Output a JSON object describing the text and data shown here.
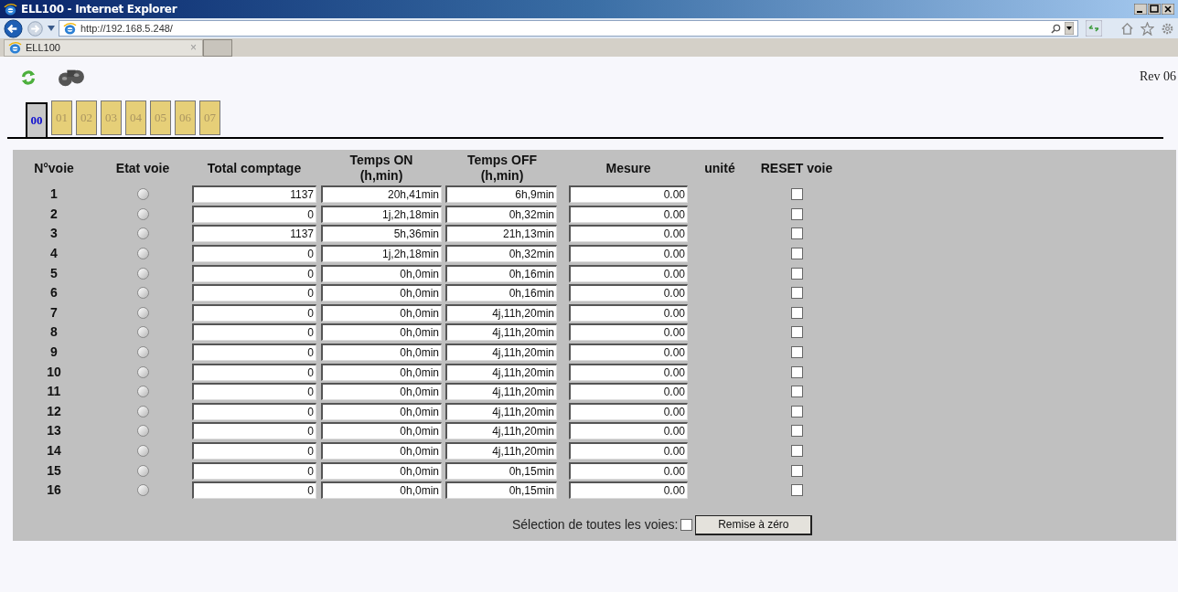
{
  "window": {
    "title": "ELL100 - Internet Explorer"
  },
  "address_bar": {
    "url": "http://192.168.5.248/"
  },
  "browser_tab": {
    "label": "ELL100",
    "close": "×"
  },
  "page": {
    "revision": "Rev 06",
    "tabs": [
      {
        "label": "00",
        "selected": true
      },
      {
        "label": "01",
        "selected": false
      },
      {
        "label": "02",
        "selected": false
      },
      {
        "label": "03",
        "selected": false
      },
      {
        "label": "04",
        "selected": false
      },
      {
        "label": "05",
        "selected": false
      },
      {
        "label": "06",
        "selected": false
      },
      {
        "label": "07",
        "selected": false
      }
    ],
    "columns": [
      "N°voie",
      "Etat voie",
      "Total comptage",
      "Temps ON\n(h,min)",
      "Temps OFF\n(h,min)",
      "Mesure",
      "unité",
      "RESET voie"
    ],
    "rows": [
      {
        "channel": "1",
        "on": false,
        "total": "1137",
        "time_on": "20h,41min",
        "time_off": "6h,9min",
        "measure": "0.00",
        "reset": false
      },
      {
        "channel": "2",
        "on": false,
        "total": "0",
        "time_on": "1j,2h,18min",
        "time_off": "0h,32min",
        "measure": "0.00",
        "reset": false
      },
      {
        "channel": "3",
        "on": false,
        "total": "1137",
        "time_on": "5h,36min",
        "time_off": "21h,13min",
        "measure": "0.00",
        "reset": false
      },
      {
        "channel": "4",
        "on": false,
        "total": "0",
        "time_on": "1j,2h,18min",
        "time_off": "0h,32min",
        "measure": "0.00",
        "reset": false
      },
      {
        "channel": "5",
        "on": false,
        "total": "0",
        "time_on": "0h,0min",
        "time_off": "0h,16min",
        "measure": "0.00",
        "reset": false
      },
      {
        "channel": "6",
        "on": false,
        "total": "0",
        "time_on": "0h,0min",
        "time_off": "0h,16min",
        "measure": "0.00",
        "reset": false
      },
      {
        "channel": "7",
        "on": false,
        "total": "0",
        "time_on": "0h,0min",
        "time_off": "4j,11h,20min",
        "measure": "0.00",
        "reset": false
      },
      {
        "channel": "8",
        "on": false,
        "total": "0",
        "time_on": "0h,0min",
        "time_off": "4j,11h,20min",
        "measure": "0.00",
        "reset": false
      },
      {
        "channel": "9",
        "on": false,
        "total": "0",
        "time_on": "0h,0min",
        "time_off": "4j,11h,20min",
        "measure": "0.00",
        "reset": false
      },
      {
        "channel": "10",
        "on": false,
        "total": "0",
        "time_on": "0h,0min",
        "time_off": "4j,11h,20min",
        "measure": "0.00",
        "reset": false
      },
      {
        "channel": "11",
        "on": false,
        "total": "0",
        "time_on": "0h,0min",
        "time_off": "4j,11h,20min",
        "measure": "0.00",
        "reset": false
      },
      {
        "channel": "12",
        "on": false,
        "total": "0",
        "time_on": "0h,0min",
        "time_off": "4j,11h,20min",
        "measure": "0.00",
        "reset": false
      },
      {
        "channel": "13",
        "on": false,
        "total": "0",
        "time_on": "0h,0min",
        "time_off": "4j,11h,20min",
        "measure": "0.00",
        "reset": false
      },
      {
        "channel": "14",
        "on": false,
        "total": "0",
        "time_on": "0h,0min",
        "time_off": "4j,11h,20min",
        "measure": "0.00",
        "reset": false
      },
      {
        "channel": "15",
        "on": false,
        "total": "0",
        "time_on": "0h,0min",
        "time_off": "0h,15min",
        "measure": "0.00",
        "reset": false
      },
      {
        "channel": "16",
        "on": false,
        "total": "0",
        "time_on": "0h,0min",
        "time_off": "0h,15min",
        "measure": "0.00",
        "reset": false
      }
    ],
    "select_all": {
      "label": "Sélection de toutes les voies:",
      "checked": false
    },
    "reset_button": "Remise à zéro"
  }
}
